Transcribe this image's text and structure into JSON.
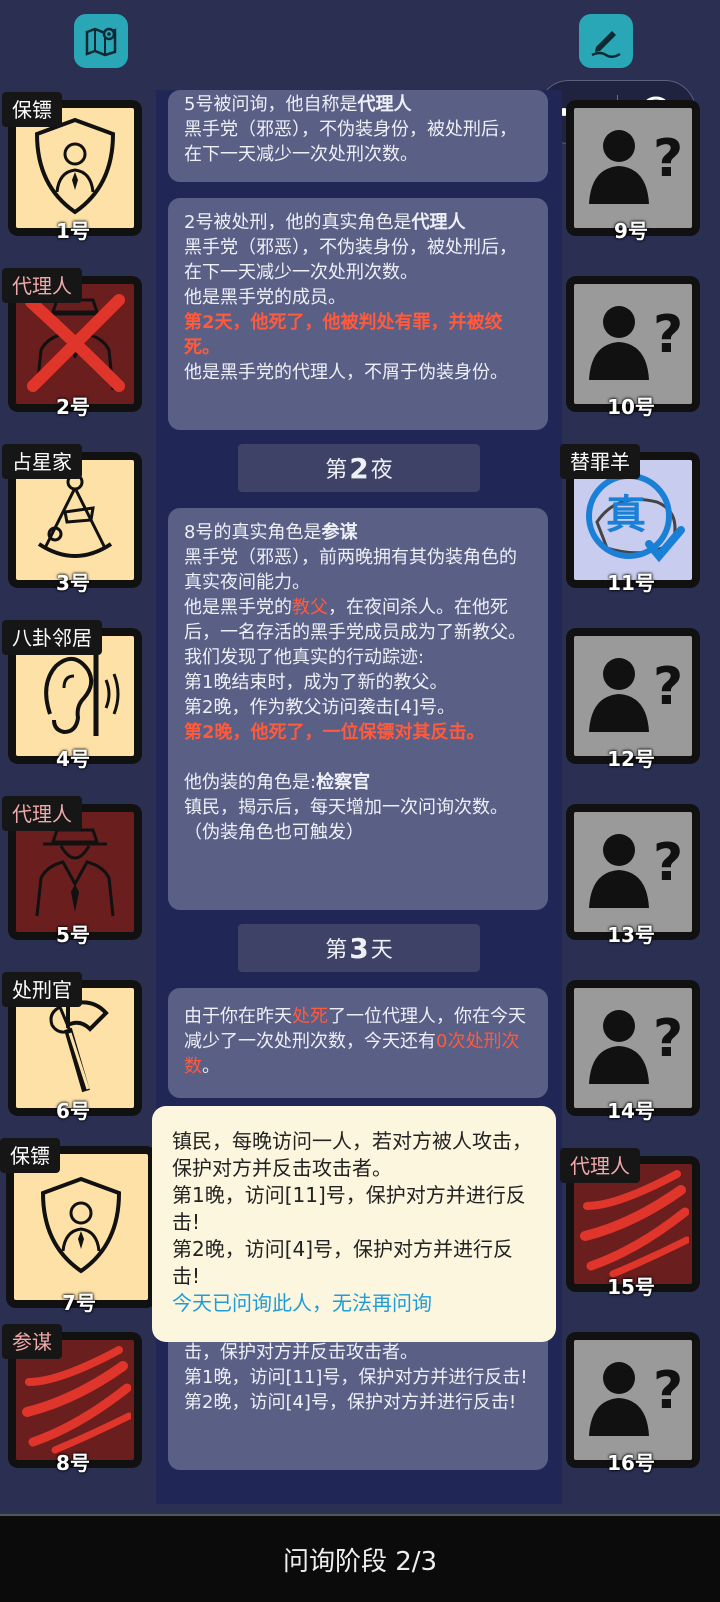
{
  "toolbar": {
    "map_icon": "map-pin-icon",
    "edit_icon": "edit-pen-icon"
  },
  "capsule": {
    "more_icon": "more-dots-icon",
    "close_icon": "record-circle-icon"
  },
  "log": {
    "card1": {
      "line1_a": "5号被问询，他自称是",
      "line1_b": "代理人",
      "line2": "黑手党（邪恶），不伪装身份，被处刑后，在下一天减少一次处刑次数。"
    },
    "card2": {
      "line1_a": "2号被处刑，他的真实角色是",
      "line1_b": "代理人",
      "line2": "黑手党（邪恶），不伪装身份，被处刑后，在下一天减少一次处刑次数。",
      "line3": "他是黑手党的成员。",
      "line4": "第2天，他死了，他被判处有罪，并被绞死。",
      "line5": "他是黑手党的代理人，不屑于伪装身份。"
    },
    "header_night2": {
      "pre": "第",
      "num": "2",
      "post": "夜"
    },
    "card3": {
      "line1_a": "8号的真实角色是",
      "line1_b": "参谋",
      "line2": "黑手党（邪恶），前两晚拥有其伪装角色的真实夜间能力。",
      "line3_a": "他是黑手党的",
      "line3_b": "教父",
      "line3_c": "，在夜间杀人。在他死后，一名存活的黑手党成员成为了新教父。",
      "line4": "我们发现了他真实的行动踪迹:",
      "line5": "第1晚结束时，成为了新的教父。",
      "line6": "第2晚，作为教父访问袭击[4]号。",
      "line7": "第2晚，他死了，一位保镖对其反击。",
      "line8_a": "他伪装的角色是:",
      "line8_b": "检察官",
      "line9": "镇民，揭示后，每天增加一次问询次数。（伪装角色也可触发）"
    },
    "header_day3": {
      "pre": "第",
      "num": "3",
      "post": "天"
    },
    "card4": {
      "line1_a": "由于你在昨天",
      "line1_b": "处死",
      "line1_c": "了一位代理人，你在今天减少了一次处刑次数，今天还有",
      "line1_d": "0次处刑次数",
      "line1_e": "。"
    },
    "card5": {
      "line0": "击，保护对方并反击攻击者。",
      "line1": "第1晚，访问[11]号，保护对方并进行反击!",
      "line2": "第2晚，访问[4]号，保护对方并进行反击!"
    }
  },
  "players_left": [
    {
      "role": "保镖",
      "num": "1号",
      "bg": "cream",
      "icon": "bodyguard-shield-icon"
    },
    {
      "role": "代理人",
      "num": "2号",
      "bg": "dark",
      "icon": "agent-crossed-icon"
    },
    {
      "role": "占星家",
      "num": "3号",
      "bg": "cream",
      "icon": "sextant-icon"
    },
    {
      "role": "八卦邻居",
      "num": "4号",
      "bg": "cream",
      "icon": "ear-wall-icon"
    },
    {
      "role": "代理人",
      "num": "5号",
      "bg": "dark",
      "icon": "agent-suit-icon"
    },
    {
      "role": "处刑官",
      "num": "6号",
      "bg": "cream",
      "icon": "axe-icon"
    },
    {
      "role": "保镖",
      "num": "7号",
      "bg": "cream",
      "icon": "bodyguard-shield-icon"
    },
    {
      "role": "参谋",
      "num": "8号",
      "bg": "dark",
      "icon": "claw-slash-icon"
    }
  ],
  "players_right": [
    {
      "role": "",
      "num": "9号",
      "bg": "gray",
      "icon": "unknown-person-icon"
    },
    {
      "role": "",
      "num": "10号",
      "bg": "gray",
      "icon": "unknown-person-icon"
    },
    {
      "role": "替罪羊",
      "num": "11号",
      "bg": "lav",
      "icon": "true-stamp-icon",
      "stamp": "真"
    },
    {
      "role": "",
      "num": "12号",
      "bg": "gray",
      "icon": "unknown-person-icon"
    },
    {
      "role": "",
      "num": "13号",
      "bg": "gray",
      "icon": "unknown-person-icon"
    },
    {
      "role": "",
      "num": "14号",
      "bg": "gray",
      "icon": "unknown-person-icon"
    },
    {
      "role": "代理人",
      "num": "15号",
      "bg": "dark",
      "icon": "claw-slash-icon"
    },
    {
      "role": "",
      "num": "16号",
      "bg": "gray",
      "icon": "unknown-person-icon"
    }
  ],
  "popup": {
    "line1": "镇民，每晚访问一人，若对方被人攻击，保护对方并反击攻击者。",
    "line2": "第1晚，访问[11]号，保护对方并进行反击!",
    "line3": "第2晚，访问[4]号，保护对方并进行反击!",
    "notice": "今天已问询此人，无法再问询"
  },
  "footer": {
    "phase": "问询阶段 2/3"
  }
}
